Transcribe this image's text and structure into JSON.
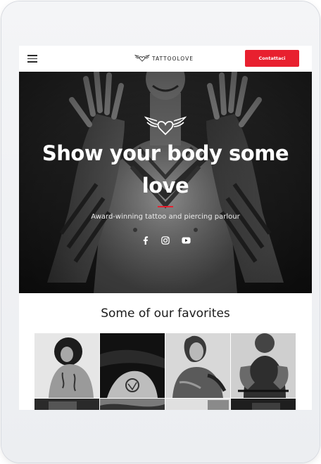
{
  "header": {
    "menu_icon": "hamburger-menu-icon",
    "logo_text": "TATTOOLOVE",
    "logo_icon": "winged-heart-icon",
    "cta_label": "Contattaci"
  },
  "hero": {
    "title": "Show your body some love",
    "subtitle": "Award-winning tattoo and piercing parlour",
    "emblem_icon": "winged-heart-icon",
    "socials": [
      "facebook-icon",
      "instagram-icon",
      "youtube-icon"
    ]
  },
  "favorites": {
    "title": "Some of our favorites",
    "photos": [
      "photo-woman-back-tattoo",
      "photo-thigh-tattoo",
      "photo-woman-arm-tattoos",
      "photo-man-sleeve-tattoos",
      "photo-tattoo-5",
      "photo-tattoo-6",
      "photo-tattoo-7",
      "photo-tattoo-8"
    ]
  },
  "colors": {
    "accent": "#e8202f",
    "hero_bg": "#1a1a1a",
    "frame": "#eceef1"
  }
}
